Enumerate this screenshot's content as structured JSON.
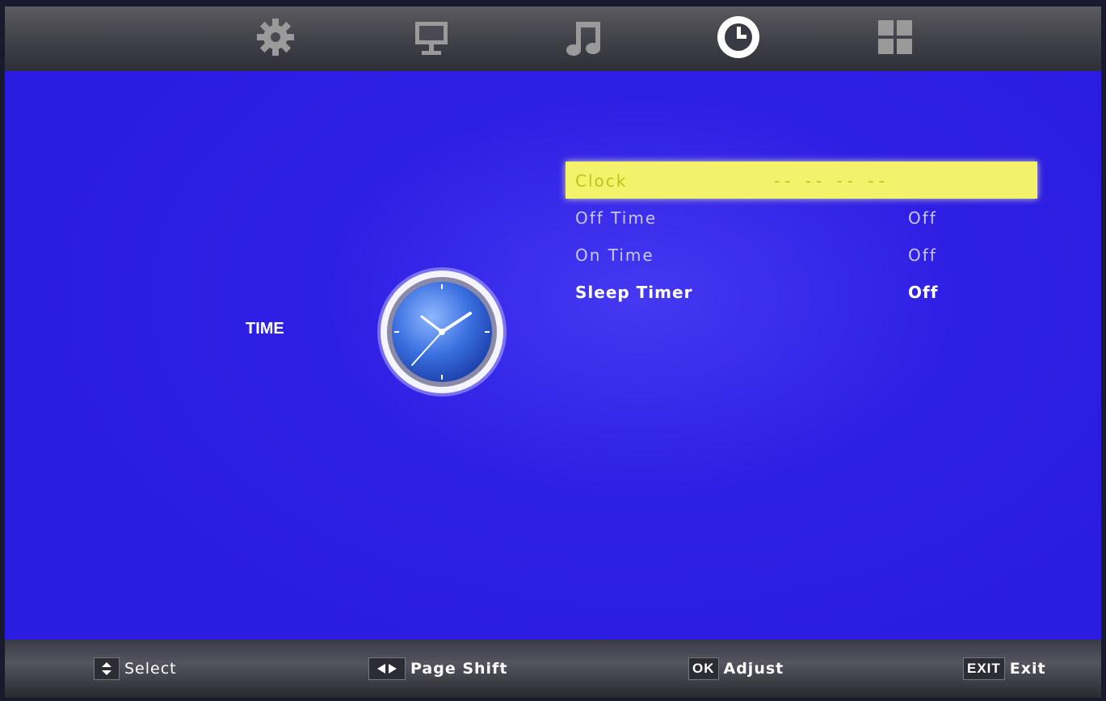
{
  "tabs": [
    {
      "name": "settings",
      "icon": "gear-icon",
      "active": false
    },
    {
      "name": "picture",
      "icon": "monitor-icon",
      "active": false
    },
    {
      "name": "sound",
      "icon": "music-note-icon",
      "active": false
    },
    {
      "name": "time",
      "icon": "clock-icon",
      "active": true
    },
    {
      "name": "option",
      "icon": "grid-icon",
      "active": false
    }
  ],
  "page": {
    "section_label": "TIME",
    "section_icon": "analog-clock-icon"
  },
  "menu": {
    "clock": {
      "label": "Clock",
      "value": "-- --  -- --"
    },
    "off_time": {
      "label": "Off Time",
      "value": "Off"
    },
    "on_time": {
      "label": "On Time",
      "value": "Off"
    },
    "sleep_timer": {
      "label": "Sleep Timer",
      "value": "Off"
    }
  },
  "footer": {
    "select": {
      "key_icon": "up-down-arrows-icon",
      "label": "Select"
    },
    "page_shift": {
      "key_icon": "left-right-arrows-icon",
      "label": "Page Shift"
    },
    "adjust": {
      "key": "OK",
      "label": "Adjust"
    },
    "exit": {
      "key": "EXIT",
      "label": "Exit"
    }
  },
  "colors": {
    "background": "#2a1ce0",
    "highlight": "#f4f26a",
    "text": "#c8c8ff"
  }
}
